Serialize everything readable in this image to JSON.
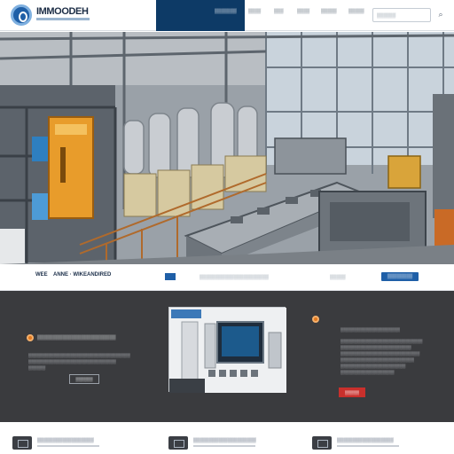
{
  "header": {
    "brand": "IMMOODEH",
    "nav": [
      "▒▒▒▒▒▒▒",
      "▒▒▒▒",
      "▒▒▒",
      "▒▒▒▒",
      "▒▒▒▒▒"
    ],
    "search_placeholder": "▒▒▒▒▒▒",
    "colors": {
      "nav_active_bg": "#0d3a66",
      "accent": "#1f5fa7"
    }
  },
  "tabs": {
    "labels": [
      "WEE",
      "ANNE · WIKE",
      "ANDIRED"
    ],
    "middle": "▒▒▒▒▒▒▒▒▒▒▒▒▒▒▒▒▒▒▒▒▒▒",
    "right": "▒▒▒▒▒",
    "button": "▒▒▒▒▒▒▒▒"
  },
  "panel": {
    "left": {
      "title": "▒▒▒▒▒▒▒▒▒▒▒▒▒▒▒▒▒▒▒▒▒▒▒▒▒",
      "lines": [
        "▒▒▒▒▒▒▒▒▒▒▒▒▒▒▒▒▒▒▒▒▒▒▒▒▒▒▒▒▒▒▒▒▒▒▒▒",
        "▒▒▒▒▒▒▒▒▒▒▒▒▒▒▒▒▒▒▒▒▒▒▒▒▒▒▒▒▒▒▒",
        "▒▒▒▒▒▒▒▒▒▒▒▒▒▒▒▒▒▒▒▒▒▒▒▒▒▒▒▒▒▒▒▒▒▒",
        "▒▒▒▒▒▒"
      ],
      "button": "▒▒▒▒▒▒"
    },
    "right": {
      "title": "▒▒▒▒▒▒▒▒▒▒▒▒▒▒▒▒▒▒▒▒▒",
      "lines": [
        "▒▒▒▒▒▒▒▒▒▒▒▒▒▒▒▒▒▒▒▒▒▒▒▒▒▒▒▒▒",
        "▒▒▒▒▒▒▒▒▒▒▒▒▒▒▒▒▒▒▒▒▒▒▒▒▒",
        "▒▒▒▒▒▒▒▒▒▒▒▒▒▒▒▒▒▒▒▒▒▒▒▒▒▒▒▒",
        "▒▒▒▒▒▒▒▒▒▒▒▒▒▒▒▒▒▒▒▒▒▒▒▒▒▒",
        "▒▒▒▒▒▒▒▒▒▒▒▒▒▒▒▒▒▒▒▒▒▒▒",
        "▒▒▒▒▒▒▒▒▒▒▒▒▒▒▒▒▒▒▒"
      ],
      "button": "▒▒▒▒▒"
    }
  },
  "footer": {
    "items": [
      "▒▒▒▒▒▒▒▒▒▒▒▒▒▒▒▒▒▒",
      "▒▒▒▒▒▒▒▒▒▒▒▒▒▒▒▒▒▒▒▒",
      "▒▒▒▒▒▒▒▒▒▒▒▒▒▒▒▒▒▒"
    ]
  },
  "hero": {
    "image": "industrial factory floor with machinery, steel tanks, yellow control cabinet and conveyor lines"
  },
  "colors": {
    "panel_bg": "#3a3b3e",
    "accent_orange": "#e2791f",
    "accent_red": "#c9302c"
  }
}
